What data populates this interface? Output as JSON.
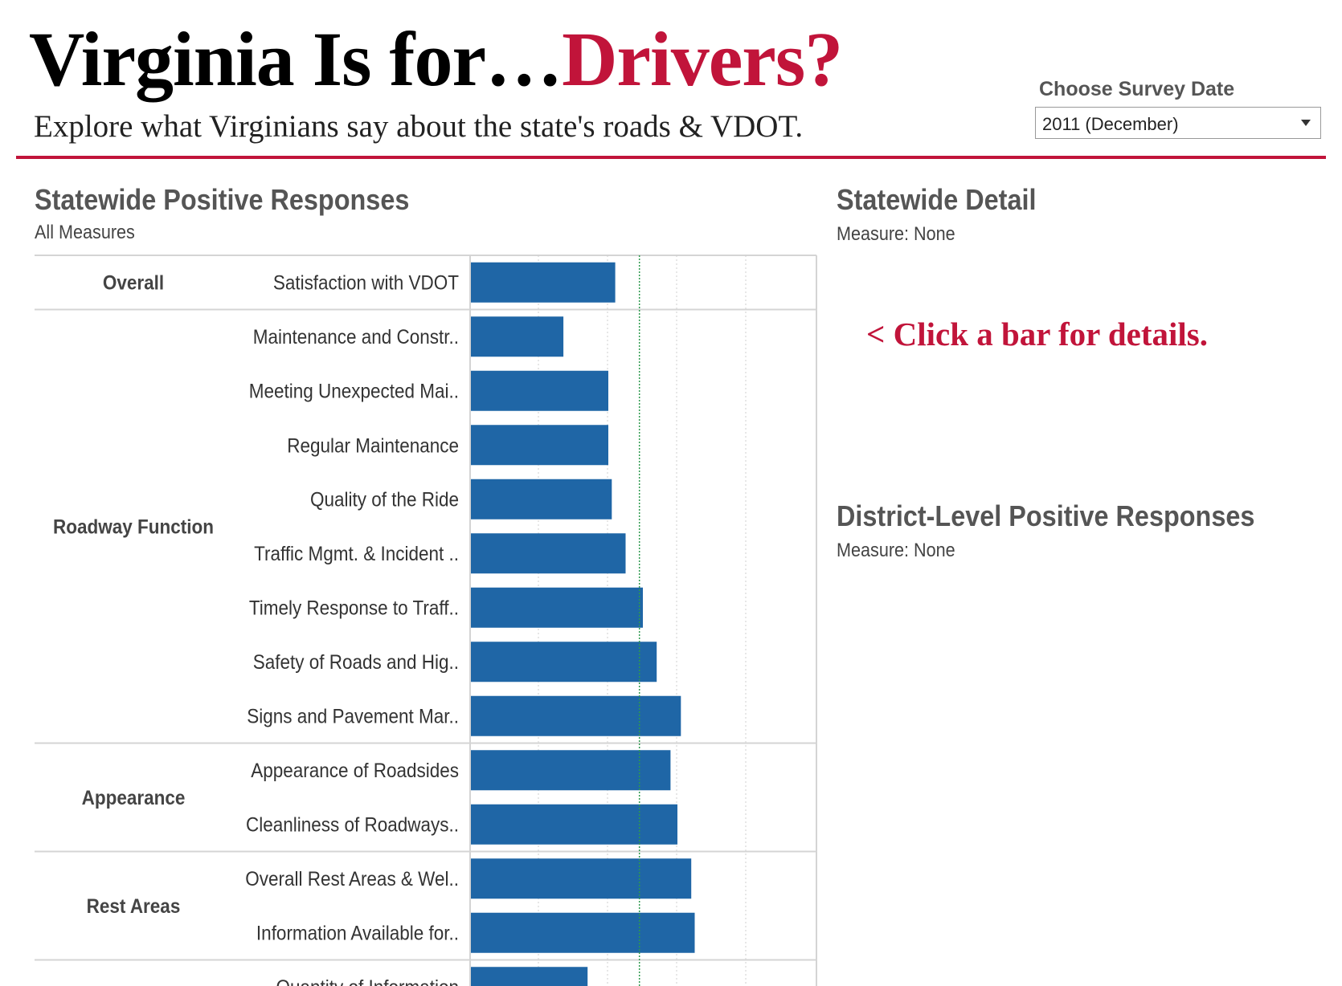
{
  "header": {
    "title_main": "Virginia Is for…",
    "title_accent": "Drivers?",
    "subtitle": "Explore what Virginians say about the state's roads & VDOT."
  },
  "survey_date": {
    "label": "Choose Survey Date",
    "selected": "2011 (December)"
  },
  "left_panel": {
    "title": "Statewide Positive Responses",
    "subtitle": "All Measures"
  },
  "right_panel": {
    "detail_title": "Statewide Detail",
    "detail_measure": "Measure: None",
    "hint": "< Click a bar for details.",
    "district_title": "District-Level Positive Responses",
    "district_measure": "Measure: None"
  },
  "colors": {
    "accent": "#c1143a",
    "bar": "#1f66a6",
    "reference_line": "#2e9a4e"
  },
  "chart_data": {
    "type": "bar",
    "orientation": "horizontal",
    "xlim": [
      0,
      1
    ],
    "grid": true,
    "reference_line": 0.49,
    "groups": [
      {
        "name": "Overall",
        "categories": [
          "Satisfaction with VDOT"
        ],
        "values": [
          0.42
        ]
      },
      {
        "name": "Roadway Function",
        "categories": [
          "Maintenance and Constr..",
          "Meeting Unexpected Mai..",
          "Regular Maintenance",
          "Quality of the Ride",
          "Traffic Mgmt. & Incident ..",
          "Timely Response to Traff..",
          "Safety of Roads and Hig..",
          "Signs and Pavement Mar.."
        ],
        "values": [
          0.27,
          0.4,
          0.4,
          0.41,
          0.45,
          0.5,
          0.54,
          0.61
        ]
      },
      {
        "name": "Appearance",
        "categories": [
          "Appearance of Roadsides",
          "Cleanliness of Roadways.."
        ],
        "values": [
          0.58,
          0.6
        ]
      },
      {
        "name": "Rest Areas",
        "categories": [
          "Overall Rest Areas & Wel..",
          "Information Available for.."
        ],
        "values": [
          0.64,
          0.65
        ]
      },
      {
        "name": "",
        "categories": [
          "Quantity of Information"
        ],
        "values": [
          0.34
        ]
      }
    ]
  }
}
